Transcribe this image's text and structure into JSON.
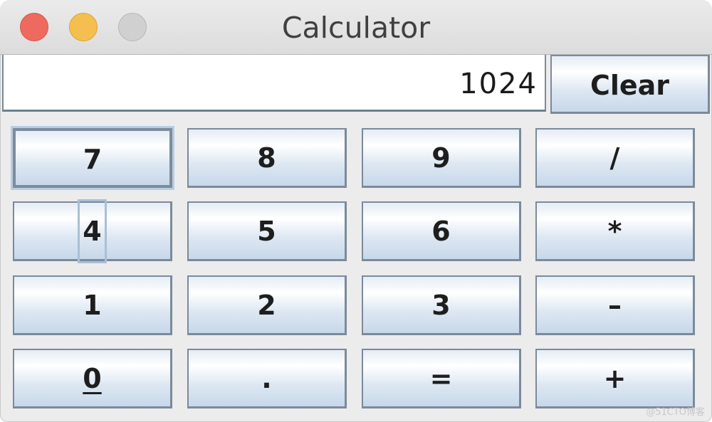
{
  "window": {
    "title": "Calculator",
    "controls": [
      "close",
      "minimize",
      "zoom"
    ]
  },
  "display": {
    "value": "1024"
  },
  "clear_button": {
    "label": "Clear"
  },
  "keypad": {
    "rows": [
      [
        {
          "label": "7",
          "name": "digit-7"
        },
        {
          "label": "8",
          "name": "digit-8"
        },
        {
          "label": "9",
          "name": "digit-9"
        },
        {
          "label": "/",
          "name": "divide"
        }
      ],
      [
        {
          "label": "4",
          "name": "digit-4"
        },
        {
          "label": "5",
          "name": "digit-5"
        },
        {
          "label": "6",
          "name": "digit-6"
        },
        {
          "label": "*",
          "name": "multiply"
        }
      ],
      [
        {
          "label": "1",
          "name": "digit-1"
        },
        {
          "label": "2",
          "name": "digit-2"
        },
        {
          "label": "3",
          "name": "digit-3"
        },
        {
          "label": "–",
          "name": "subtract"
        }
      ],
      [
        {
          "label": "0",
          "name": "digit-0"
        },
        {
          "label": ".",
          "name": "decimal-point"
        },
        {
          "label": "=",
          "name": "equals"
        },
        {
          "label": "+",
          "name": "add"
        }
      ]
    ],
    "focused_button": "7",
    "mnemonic_button": "0"
  },
  "watermark": "@51CTO博客"
}
